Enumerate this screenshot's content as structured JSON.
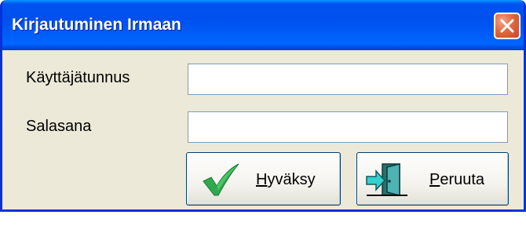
{
  "window": {
    "title": "Kirjautuminen Irmaan"
  },
  "form": {
    "username_label": "Käyttäjätunnus",
    "username_value": "",
    "password_label": "Salasana",
    "password_value": ""
  },
  "buttons": {
    "accept": {
      "mnemonic": "H",
      "rest": "yväksy",
      "icon": "checkmark-icon"
    },
    "cancel": {
      "mnemonic": "P",
      "rest": "eruuta",
      "icon": "exit-door-icon"
    }
  },
  "colors": {
    "title_bar": "#0054e3",
    "close_button": "#e0683f",
    "window_bg": "#ece9d8",
    "checkmark": "#2fa84f",
    "door": "#3a8c8c"
  }
}
